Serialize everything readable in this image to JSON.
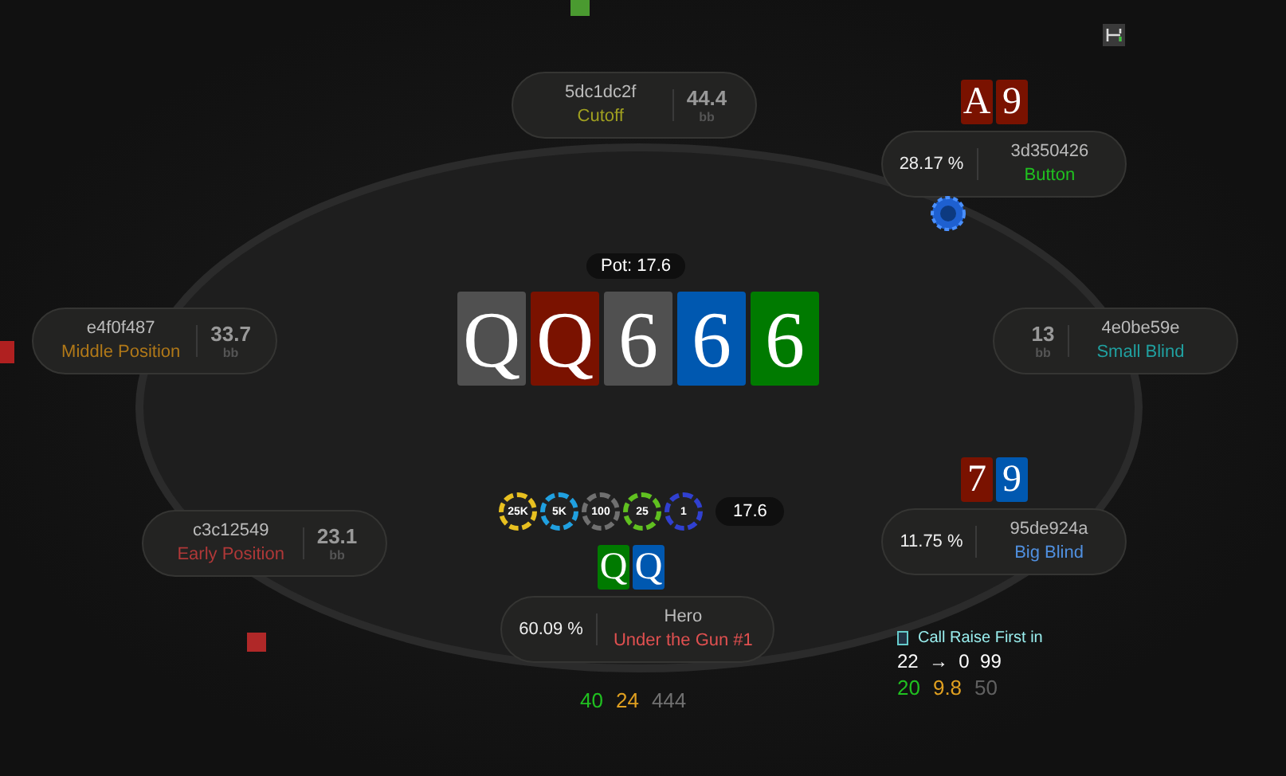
{
  "table": {
    "pot": "Pot: 17.6",
    "board": [
      {
        "rank": "Q",
        "color": "#505050"
      },
      {
        "rank": "Q",
        "color": "#7a1200"
      },
      {
        "rank": "6",
        "color": "#505050"
      },
      {
        "rank": "6",
        "color": "#0058b0"
      },
      {
        "rank": "6",
        "color": "#007a00"
      }
    ],
    "bet": "17.6",
    "chips": [
      {
        "label": "25K",
        "color": "#e8c020"
      },
      {
        "label": "5K",
        "color": "#20a0e0"
      },
      {
        "label": "100",
        "color": "#707070"
      },
      {
        "label": "25",
        "color": "#60c020"
      },
      {
        "label": "1",
        "color": "#3040d0"
      }
    ]
  },
  "seats": [
    {
      "kind": "stackright",
      "name": "5dc1dc2f",
      "position": "Cutoff",
      "color": "#a0a020",
      "stack": "44.4",
      "unit": "bb"
    },
    {
      "kind": "equity",
      "name": "3d350426",
      "position": "Button",
      "color": "#20c020",
      "equity": "28.17 %",
      "cards": [
        {
          "rank": "A",
          "color": "#7a1200"
        },
        {
          "rank": "9",
          "color": "#7a1200"
        }
      ],
      "dealer": true
    },
    {
      "kind": "stackright",
      "name": "e4f0f487",
      "position": "Middle Position",
      "color": "#b07818",
      "stack": "33.7",
      "unit": "bb"
    },
    {
      "kind": "stackleft",
      "name": "4e0be59e",
      "position": "Small Blind",
      "color": "#20a0a0",
      "stack": "13",
      "unit": "bb"
    },
    {
      "kind": "stackright",
      "name": "c3c12549",
      "position": "Early Position",
      "color": "#b03838",
      "stack": "23.1",
      "unit": "bb"
    },
    {
      "kind": "equity",
      "name": "95de924a",
      "position": "Big Blind",
      "color": "#5090e0",
      "equity": "11.75 %",
      "cards": [
        {
          "rank": "7",
          "color": "#7a1200"
        },
        {
          "rank": "9",
          "color": "#0058b0"
        }
      ],
      "dealer": false
    },
    {
      "kind": "equity",
      "name": "Hero",
      "position": "Under the Gun #1",
      "color": "#e05050",
      "equity": "60.09 %",
      "cards": [
        {
          "rank": "Q",
          "color": "#007a00"
        },
        {
          "rank": "Q",
          "color": "#0058b0"
        }
      ],
      "dealer": false
    }
  ],
  "hero_stats": [
    {
      "value": "40",
      "color": "#20c020"
    },
    {
      "value": "24",
      "color": "#e0a020"
    },
    {
      "value": "444",
      "color": "#707070"
    }
  ],
  "action_panel": {
    "title": "Call Raise First in",
    "line": "22  →  0  99",
    "stats": [
      {
        "value": "20",
        "color": "#20c020"
      },
      {
        "value": "9.8",
        "color": "#e0a020"
      },
      {
        "value": "50",
        "color": "#606060"
      }
    ]
  }
}
